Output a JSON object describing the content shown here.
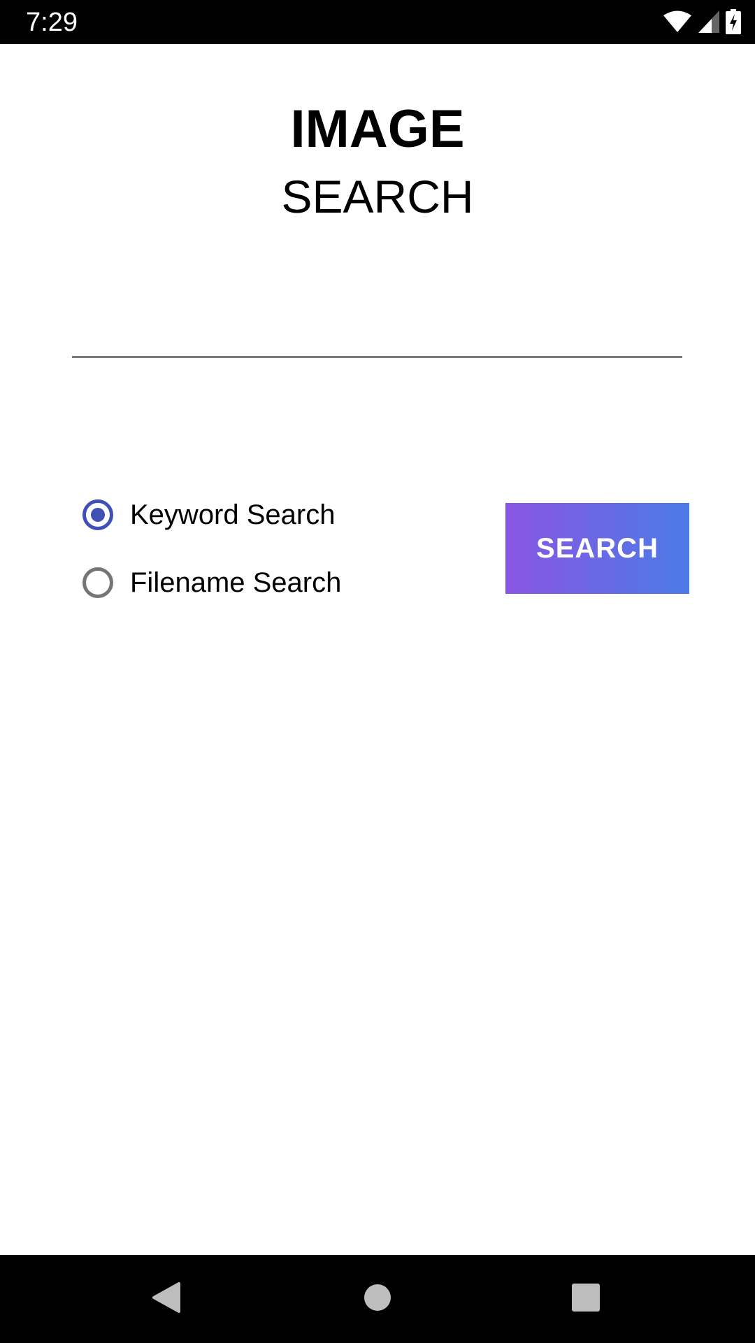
{
  "status_bar": {
    "time": "7:29",
    "icons": [
      "wifi-icon",
      "cellular-signal-icon",
      "battery-charging-icon"
    ]
  },
  "header": {
    "title": "IMAGE",
    "subtitle": "SEARCH"
  },
  "search": {
    "value": "",
    "placeholder": ""
  },
  "search_mode": {
    "options": [
      {
        "label": "Keyword Search",
        "selected": true
      },
      {
        "label": "Filename Search",
        "selected": false
      }
    ]
  },
  "actions": {
    "search_label": "SEARCH"
  },
  "colors": {
    "accent": "#3f51b5",
    "button_gradient_start": "#8a55e4",
    "button_gradient_end": "#4b7be6",
    "unselected_radio": "#757575"
  },
  "nav_bar": {
    "icons": [
      "back-icon",
      "home-icon",
      "recents-icon"
    ]
  }
}
